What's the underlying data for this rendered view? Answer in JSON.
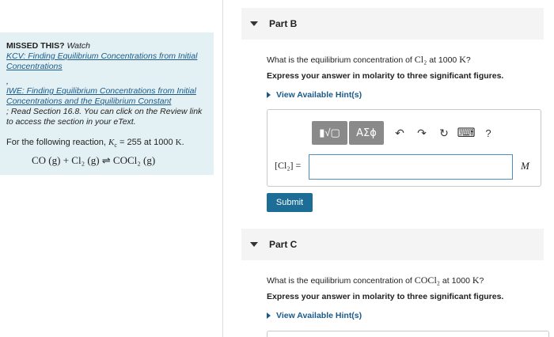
{
  "sidebar": {
    "missed_label": "MISSED THIS?",
    "watch_label": "Watch",
    "link1": "KCV: Finding Equilibrium Concentrations from Initial Concentrations",
    "comma": ",",
    "link2": "IWE: Finding Equilibrium Concentrations from Initial Concentrations and the Equilibrium Constant",
    "read_text": "; Read Section 16.8. You can click on the Review link to access the section in your eText.",
    "reaction_intro_pre": "For the following reaction,",
    "kc_symbol": "K",
    "kc_sub": "c",
    "reaction_intro_post": "= 255 at 1000",
    "temp_unit": "K",
    "reaction_intro_end": ".",
    "reaction": "CO (g) + Cl₂ (g) ⇌ COCl₂ (g)"
  },
  "partB": {
    "title": "Part B",
    "question_pre": "What is the equilibrium concentration of",
    "species": "Cl₂",
    "question_mid": "at 1000",
    "question_unit": "K",
    "question_end": "?",
    "instruction": "Express your answer in molarity to three significant figures.",
    "hint": "View Available Hint(s)",
    "answer_label": "[Cl₂] =",
    "answer_value": "",
    "answer_unit": "M",
    "toolbar": {
      "templates": "▮√▢",
      "greek": "ΑΣϕ",
      "undo": "↶",
      "redo": "↷",
      "reset": "↻",
      "keyboard": "⌨",
      "help": "?"
    },
    "submit": "Submit"
  },
  "partC": {
    "title": "Part C",
    "question_pre": "What is the equilibrium concentration of",
    "species": "COCl₂",
    "question_mid": "at 1000",
    "question_unit": "K",
    "question_end": "?",
    "instruction": "Express your answer in molarity to three significant figures.",
    "hint": "View Available Hint(s)"
  }
}
